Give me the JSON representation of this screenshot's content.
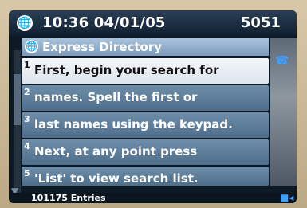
{
  "status": {
    "time_date": "10:36 04/01/05",
    "extension": "5051"
  },
  "screen": {
    "title": "Express Directory"
  },
  "items": [
    {
      "number": "1",
      "text": "First, begin your search for",
      "selected": true
    },
    {
      "number": "2",
      "text": "names. Spell the first or",
      "selected": false
    },
    {
      "number": "3",
      "text": "last names using the keypad.",
      "selected": false
    },
    {
      "number": "4",
      "text": "Next, at any point press",
      "selected": false
    },
    {
      "number": "5",
      "text": "'List' to view search list.",
      "selected": false
    }
  ],
  "footer": {
    "entries": "101175 Entries"
  },
  "colors": {
    "accent": "#3fa0ff",
    "item_background": "#5f7f9c",
    "selected_background": "#eef2f6"
  },
  "icons": {
    "status": "globe-icon",
    "title": "globe-icon",
    "side_top": "phone-icon",
    "side_bottom": "video-icon",
    "scroll": "scroll-down-arrow-icon"
  }
}
